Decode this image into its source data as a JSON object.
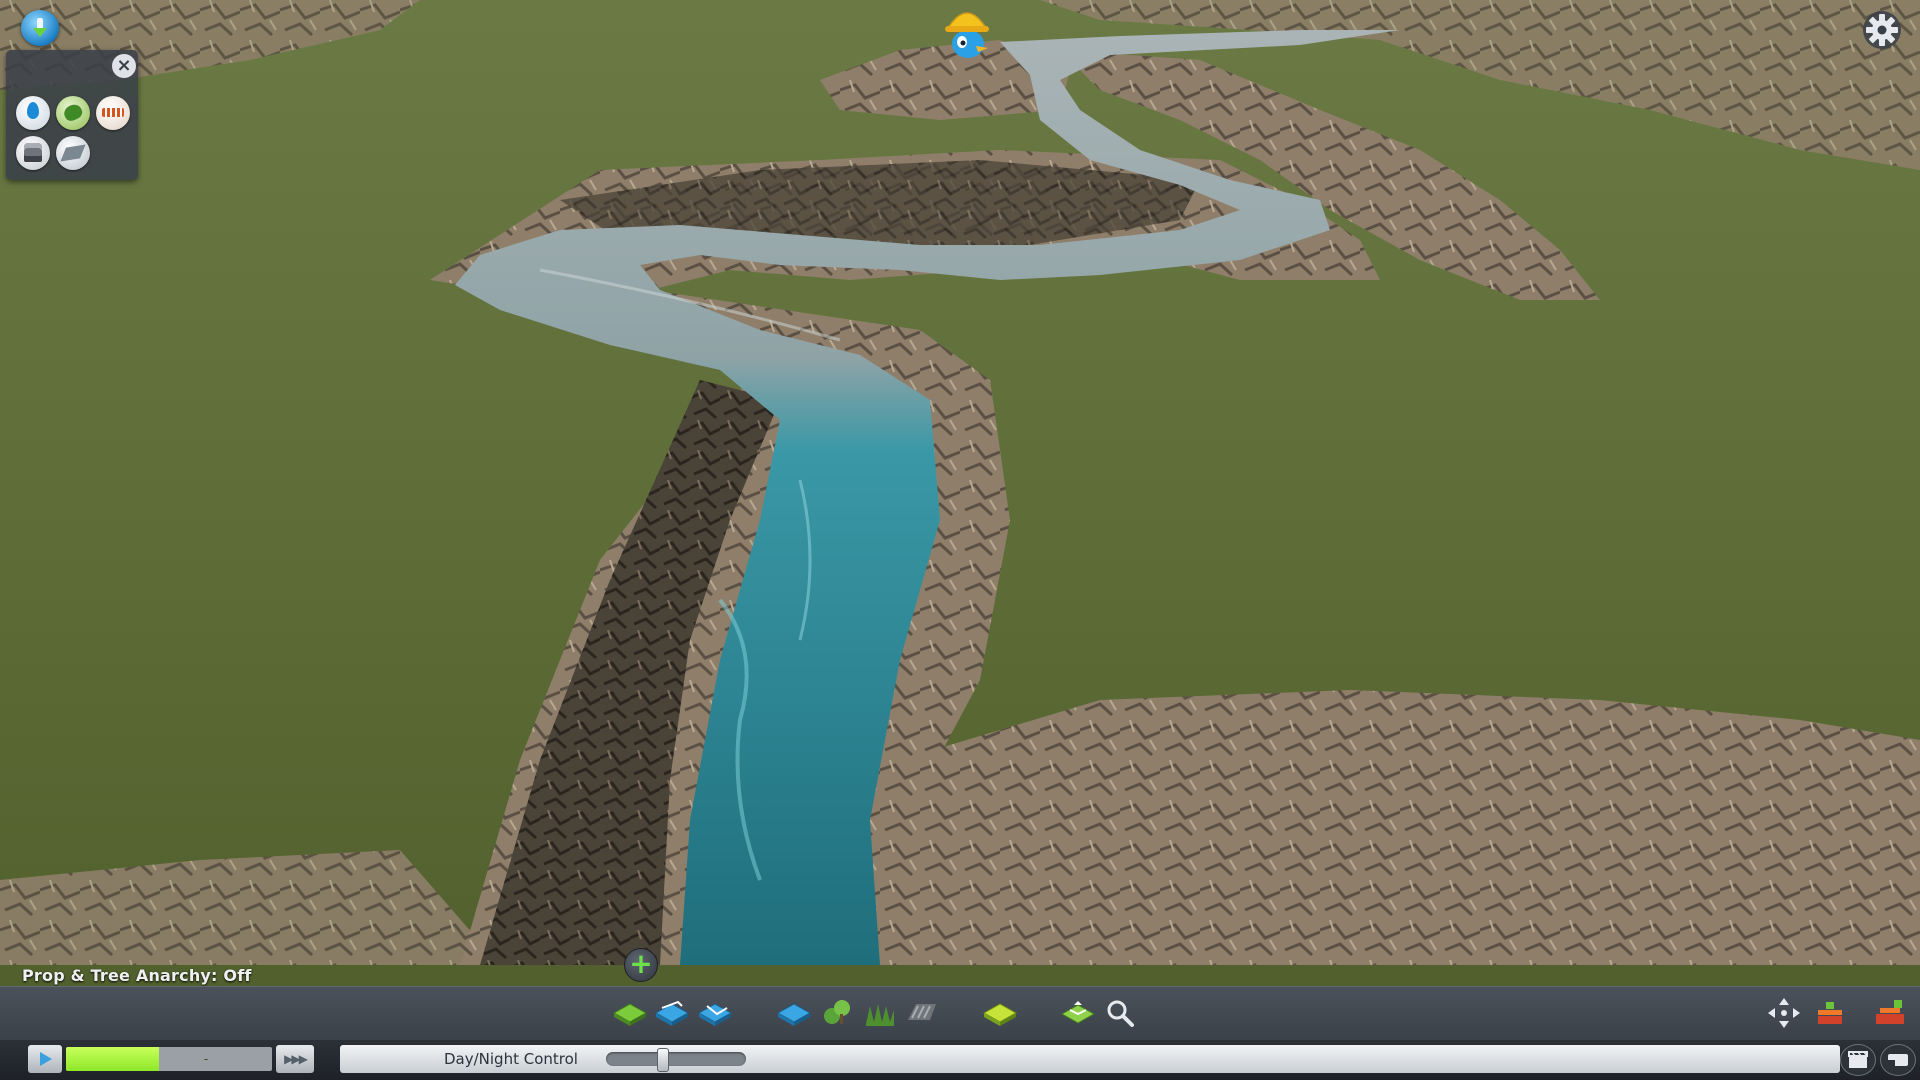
{
  "status": {
    "anarchy_text": "Prop & Tree Anarchy: Off"
  },
  "add_button": {
    "label": "+"
  },
  "toolbar": {
    "tools": [
      {
        "icon": "terrain-shift-icon"
      },
      {
        "icon": "terrain-level-icon"
      },
      {
        "icon": "terrain-slope-icon"
      },
      {
        "icon": "water-tool-icon"
      },
      {
        "icon": "trees-icon"
      },
      {
        "icon": "bushes-icon"
      },
      {
        "icon": "rock-icon"
      },
      {
        "icon": "surface-paint-icon"
      },
      {
        "icon": "map-theme-icon"
      },
      {
        "icon": "search-icon"
      }
    ],
    "right_tools": [
      {
        "icon": "move-it-icon"
      },
      {
        "icon": "asset-layers-icon"
      },
      {
        "icon": "asset-editor-icon"
      }
    ]
  },
  "time": {
    "progress_label": "-",
    "progress_fraction": 0.45,
    "speed_label": "▶▶▶"
  },
  "daynight": {
    "label": "Day/Night Control",
    "value_fraction": 0.4
  },
  "colors": {
    "grass": "#5b6a34",
    "river": "#2b8b9b",
    "rock": "#9a8a74",
    "ui_panel": "#3b4149",
    "progress": "#a4f03a"
  }
}
